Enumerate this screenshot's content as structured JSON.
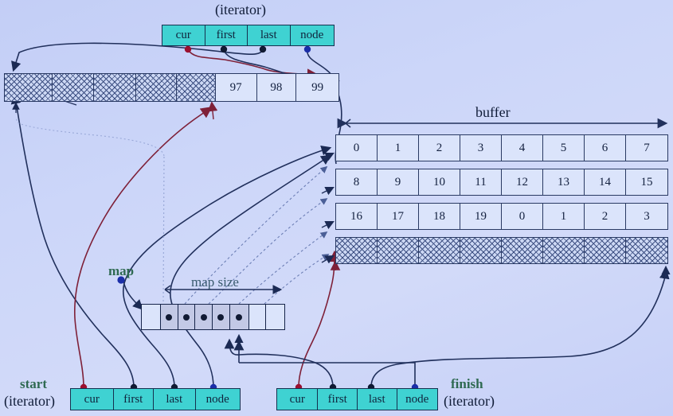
{
  "diagram": {
    "title_top_iterator": "(iterator)",
    "labels": {
      "buffer": "buffer",
      "map": "map",
      "map_size": "map  size",
      "start": "start",
      "start_sub": "(iterator)",
      "finish": "finish",
      "finish_sub": "(iterator)"
    },
    "colors": {
      "background": "#ccd6f9",
      "iterator_fill": "#3fd2d2",
      "cell_fill": "#dbe4fb",
      "map_filled": "#c3c9e6",
      "stroke": "#16244a",
      "wire_navy": "#1b2a54",
      "wire_maroon": "#7e2038",
      "dot_navy": "#111a33",
      "dot_blue": "#1b2ea8",
      "dot_red": "#9b1030",
      "label_green": "#2f6a52",
      "label_slate": "#3a5b6e"
    }
  },
  "iterators": {
    "top": {
      "name": "top-iterator",
      "caption": "(iterator)",
      "fields": [
        "cur",
        "first",
        "last",
        "node"
      ]
    },
    "start": {
      "name": "start-iterator",
      "label": "start",
      "sublabel": "(iterator)",
      "fields": [
        "cur",
        "first",
        "last",
        "node"
      ]
    },
    "finish": {
      "name": "finish-iterator",
      "label": "finish",
      "sublabel": "(iterator)",
      "fields": [
        "cur",
        "first",
        "last",
        "node"
      ]
    }
  },
  "buffers": {
    "top_row": {
      "name": "first-buffer-row",
      "cells": [
        "",
        "",
        "",
        "",
        "",
        "97",
        "98",
        "99"
      ],
      "hatched": [
        true,
        true,
        true,
        true,
        true,
        false,
        false,
        false
      ]
    },
    "right_rows": [
      {
        "name": "buffer-row-1",
        "cells": [
          "0",
          "1",
          "2",
          "3",
          "4",
          "5",
          "6",
          "7"
        ],
        "hatched": [
          false,
          false,
          false,
          false,
          false,
          false,
          false,
          false
        ]
      },
      {
        "name": "buffer-row-2",
        "cells": [
          "8",
          "9",
          "10",
          "11",
          "12",
          "13",
          "14",
          "15"
        ],
        "hatched": [
          false,
          false,
          false,
          false,
          false,
          false,
          false,
          false
        ]
      },
      {
        "name": "buffer-row-3",
        "cells": [
          "16",
          "17",
          "18",
          "19",
          "0",
          "1",
          "2",
          "3"
        ],
        "hatched": [
          false,
          false,
          false,
          false,
          false,
          false,
          false,
          false
        ]
      },
      {
        "name": "buffer-row-4",
        "cells": [
          "",
          "",
          "",
          "",
          "",
          "",
          "",
          ""
        ],
        "hatched": [
          true,
          true,
          true,
          true,
          true,
          true,
          true,
          true
        ]
      }
    ]
  },
  "map": {
    "name": "map-array",
    "cell_count": 8,
    "filled": [
      false,
      true,
      true,
      true,
      true,
      true,
      false,
      false
    ]
  }
}
